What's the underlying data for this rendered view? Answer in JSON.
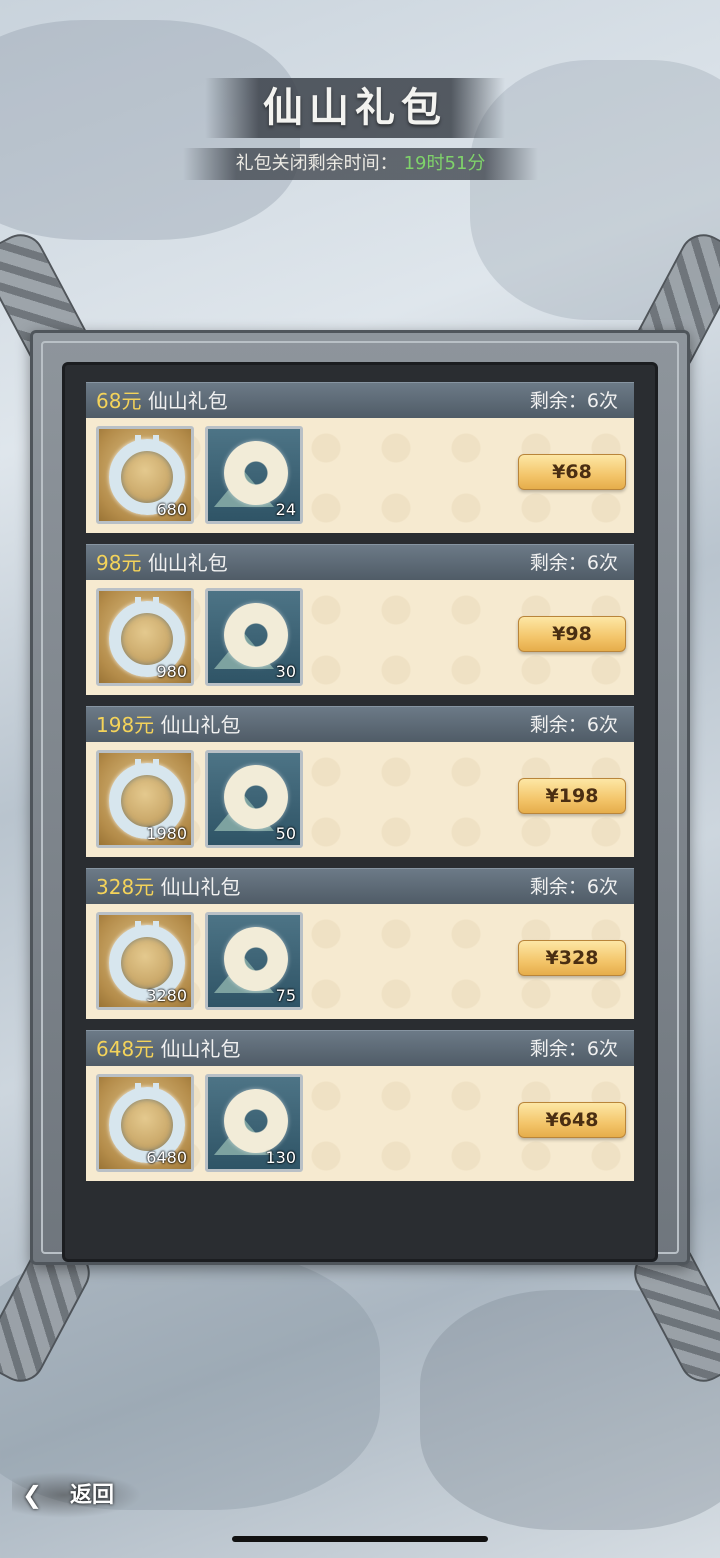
{
  "header": {
    "title": "仙山礼包",
    "subtitle_label": "礼包关闭剩余时间：",
    "timer": "19时51分"
  },
  "packages": [
    {
      "price_label": "68元",
      "name": "仙山礼包",
      "remaining": "剩余：6次",
      "items": [
        {
          "icon": "ring-icon",
          "count": "680"
        },
        {
          "icon": "jade-disc-icon",
          "count": "24"
        }
      ],
      "button": "¥68"
    },
    {
      "price_label": "98元",
      "name": "仙山礼包",
      "remaining": "剩余：6次",
      "items": [
        {
          "icon": "ring-icon",
          "count": "980"
        },
        {
          "icon": "jade-disc-icon",
          "count": "30"
        }
      ],
      "button": "¥98"
    },
    {
      "price_label": "198元",
      "name": "仙山礼包",
      "remaining": "剩余：6次",
      "items": [
        {
          "icon": "ring-icon",
          "count": "1980"
        },
        {
          "icon": "jade-disc-icon",
          "count": "50"
        }
      ],
      "button": "¥198"
    },
    {
      "price_label": "328元",
      "name": "仙山礼包",
      "remaining": "剩余：6次",
      "items": [
        {
          "icon": "ring-icon",
          "count": "3280"
        },
        {
          "icon": "jade-disc-icon",
          "count": "75"
        }
      ],
      "button": "¥328"
    },
    {
      "price_label": "648元",
      "name": "仙山礼包",
      "remaining": "剩余：6次",
      "items": [
        {
          "icon": "ring-icon",
          "count": "6480"
        },
        {
          "icon": "jade-disc-icon",
          "count": "130"
        }
      ],
      "button": "¥648"
    }
  ],
  "footer": {
    "back_label": "返回"
  },
  "colors": {
    "price_highlight": "#f4d35a",
    "timer": "#7fd36a",
    "button_gold": "#f3c56a",
    "panel_body": "#f6ead0"
  }
}
